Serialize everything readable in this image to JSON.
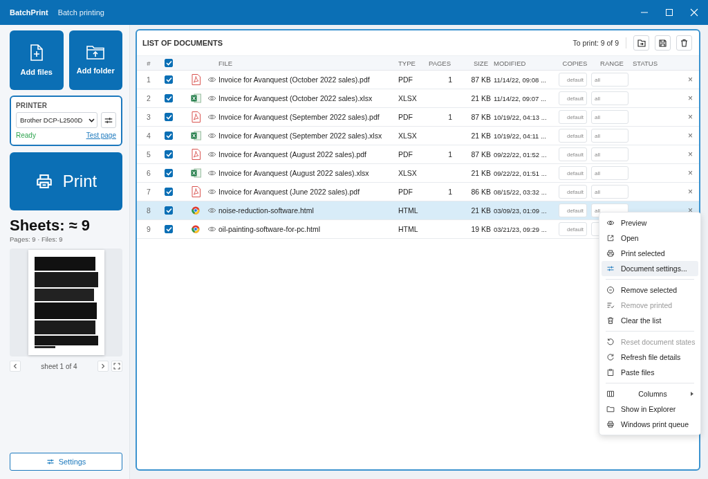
{
  "window": {
    "app_name": "BatchPrint",
    "title": "Batch printing"
  },
  "sidebar": {
    "add_files": "Add files",
    "add_folder": "Add folder",
    "printer": {
      "heading": "PRINTER",
      "value": "Brother DCP-L2500D",
      "status": "Ready",
      "test_link": "Test page"
    },
    "print_button": "Print",
    "sheets": "Sheets: ≈ 9",
    "counts": "Pages: 9 · Files: 9",
    "preview": {
      "kind": "picture",
      "pager": "sheet 1 of 4"
    },
    "settings_button": "Settings"
  },
  "documents": {
    "title": "LIST OF DOCUMENTS",
    "to_print": "To print: 9 of 9",
    "all_checked": true,
    "columns": [
      "#",
      "FILE",
      "TYPE",
      "PAGES",
      "SIZE",
      "MODIFIED",
      "COPIES",
      "RANGE",
      "STATUS"
    ],
    "rows": [
      {
        "number": "1",
        "checked": true,
        "kind": "pdf",
        "file": "Invoice for Avanquest (October 2022 sales).pdf",
        "type": "PDF",
        "pages": "1",
        "size": "87 KB",
        "modified": "11/14/22, 09:08 ...",
        "copies_placeholder": "default",
        "range_placeholder": "all",
        "remove": "×",
        "selected": false
      },
      {
        "number": "2",
        "checked": true,
        "kind": "xlsx",
        "file": "Invoice for Avanquest (October 2022 sales).xlsx",
        "type": "XLSX",
        "size": "21 KB",
        "modified": "11/14/22, 09:07 ...",
        "copies_placeholder": "default",
        "range_placeholder": "all",
        "remove": "×",
        "selected": false
      },
      {
        "number": "3",
        "checked": true,
        "kind": "pdf",
        "file": "Invoice for Avanquest (September 2022 sales).pdf",
        "type": "PDF",
        "pages": "1",
        "size": "87 KB",
        "modified": "10/19/22, 04:13 ...",
        "copies_placeholder": "default",
        "range_placeholder": "all",
        "remove": "×",
        "selected": false
      },
      {
        "number": "4",
        "checked": true,
        "kind": "xlsx",
        "file": "Invoice for Avanquest (September 2022 sales).xlsx",
        "type": "XLSX",
        "size": "21 KB",
        "modified": "10/19/22, 04:11 ...",
        "copies_placeholder": "default",
        "range_placeholder": "all",
        "remove": "×",
        "selected": false
      },
      {
        "number": "5",
        "checked": true,
        "kind": "pdf",
        "file": "Invoice for Avanquest (August 2022 sales).pdf",
        "type": "PDF",
        "pages": "1",
        "size": "87 KB",
        "modified": "09/22/22, 01:52 ...",
        "copies_placeholder": "default",
        "range_placeholder": "all",
        "remove": "×",
        "selected": false
      },
      {
        "number": "6",
        "checked": true,
        "kind": "xlsx",
        "file": "Invoice for Avanquest (August 2022 sales).xlsx",
        "type": "XLSX",
        "size": "21 KB",
        "modified": "09/22/22, 01:51 ...",
        "copies_placeholder": "default",
        "range_placeholder": "all",
        "remove": "×",
        "selected": false
      },
      {
        "number": "7",
        "checked": true,
        "kind": "pdf",
        "file": "Invoice for Avanquest (June 2022 sales).pdf",
        "type": "PDF",
        "pages": "1",
        "size": "86 KB",
        "modified": "08/15/22, 03:32 ...",
        "copies_placeholder": "default",
        "range_placeholder": "all",
        "remove": "×",
        "selected": false
      },
      {
        "number": "8",
        "checked": true,
        "kind": "html",
        "file": "noise-reduction-software.html",
        "type": "HTML",
        "size": "21 KB",
        "modified": "03/09/23, 01:09 ...",
        "copies_placeholder": "default",
        "range_placeholder": "all",
        "remove": "×",
        "selected": true
      },
      {
        "number": "9",
        "checked": true,
        "kind": "html",
        "file": "oil-painting-software-for-pc.html",
        "type": "HTML",
        "size": "19 KB",
        "modified": "03/21/23, 09:29 ...",
        "copies_placeholder": "default",
        "selected": false
      }
    ]
  },
  "context_menu": {
    "groups": [
      {
        "items": [
          {
            "label": "Preview",
            "disabled": false,
            "selected": false
          },
          {
            "label": "Open",
            "disabled": false,
            "selected": false
          },
          {
            "label": "Print selected",
            "disabled": false,
            "selected": false
          },
          {
            "label": "Document settings...",
            "disabled": false,
            "selected": true
          }
        ]
      },
      {
        "items": [
          {
            "label": "Remove selected",
            "disabled": false,
            "selected": false
          },
          {
            "label": "Remove printed",
            "disabled": true,
            "selected": false
          },
          {
            "label": "Clear the list",
            "disabled": false,
            "selected": false
          }
        ]
      },
      {
        "items": [
          {
            "label": "Reset document states",
            "disabled": true,
            "selected": false
          },
          {
            "label": "Refresh file details",
            "disabled": false,
            "selected": false
          },
          {
            "label": "Paste files",
            "disabled": false,
            "selected": false
          }
        ]
      },
      {
        "items": [
          {
            "label": "Columns",
            "disabled": false,
            "selected": false,
            "submenu": true
          },
          {
            "label": "Show in Explorer",
            "disabled": false,
            "selected": false
          },
          {
            "label": "Windows print queue",
            "disabled": false,
            "selected": false
          }
        ]
      }
    ]
  }
}
